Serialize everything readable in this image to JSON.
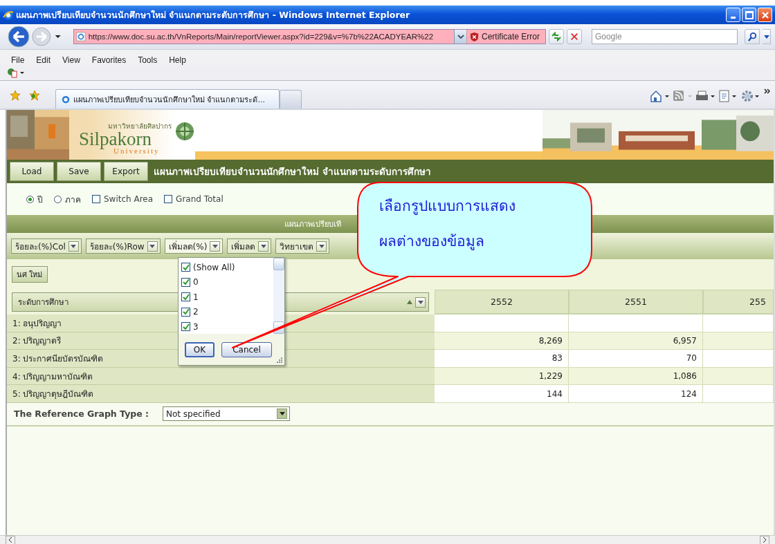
{
  "window": {
    "title": "แผนภาพเปรียบเทียบจำนวนนักศึกษาใหม่ จำแนกตามระดับการศึกษา - Windows Internet Explorer"
  },
  "address_bar": {
    "url": "https://www.doc.su.ac.th/VnReports/Main/reportViewer.aspx?id=229&v=%7b%22ACADYEAR%22",
    "certificate": "Certificate Error"
  },
  "search": {
    "placeholder": "Google"
  },
  "menu": [
    "File",
    "Edit",
    "View",
    "Favorites",
    "Tools",
    "Help"
  ],
  "tabs": [
    {
      "label": "แผนภาพเปรียบเทียบจำนวนนักศึกษาใหม่ จำแนกตามระดั...",
      "selected": true
    }
  ],
  "banner": {
    "thai": "มหาวิทยาลัยศิลปากร",
    "name": "Silpakorn",
    "subtitle": "University"
  },
  "toolbar": {
    "buttons": [
      "Load",
      "Save",
      "Export"
    ],
    "title": "แผนภาพเปรียบเทียบจำนวนนักศึกษาใหม่ จำแนกตามระดับการศึกษา"
  },
  "options": [
    {
      "kind": "radio",
      "label": "ปี",
      "selected": true
    },
    {
      "kind": "radio",
      "label": "ภาค",
      "selected": false
    },
    {
      "kind": "checkbox",
      "label": "Switch Area",
      "checked": false
    },
    {
      "kind": "checkbox",
      "label": "Grand Total",
      "checked": false
    }
  ],
  "chart_header": "แผนภาพเปรียบเที",
  "filter_fields": [
    {
      "label": "ร้อยละ(%)Col",
      "expanded": false
    },
    {
      "label": "ร้อยละ(%)Row",
      "expanded": false
    },
    {
      "label": "เพิ่มลด(%)",
      "expanded": true
    },
    {
      "label": "เพิ่มลด",
      "expanded": false
    },
    {
      "label": "วิทยาเขต",
      "expanded": false
    }
  ],
  "filter_popup": {
    "items": [
      {
        "label": "(Show All)",
        "checked": true
      },
      {
        "label": "0",
        "checked": true
      },
      {
        "label": "1",
        "checked": true
      },
      {
        "label": "2",
        "checked": true
      },
      {
        "label": "3",
        "checked": true
      }
    ],
    "buttons": [
      "OK",
      "Cancel"
    ]
  },
  "data_field": "นศ ใหม่",
  "row_field": "ระดับการศึกษา",
  "table": {
    "columns": [
      "2552",
      "2551",
      "255"
    ],
    "rows": [
      {
        "label": "1: อนุปริญญา"
      },
      {
        "label": "2: ปริญญาตรี",
        "values": [
          "8,269",
          "6,957"
        ]
      },
      {
        "label": "3: ประกาศนียบัตรบัณฑิต",
        "values": [
          "83",
          "70"
        ]
      },
      {
        "label": "4: ปริญญามหาบัณฑิต",
        "values": [
          "1,229",
          "1,086"
        ]
      },
      {
        "label": "5: ปริญญาดุษฎีบัณฑิต",
        "values": [
          "144",
          "124"
        ]
      }
    ]
  },
  "reference_graph": {
    "label": "The Reference Graph Type :",
    "value": "Not specified"
  },
  "callout": {
    "lines": [
      "เลือกรูปแบบการแสดง",
      "ผลต่างของข้อมูล"
    ]
  }
}
